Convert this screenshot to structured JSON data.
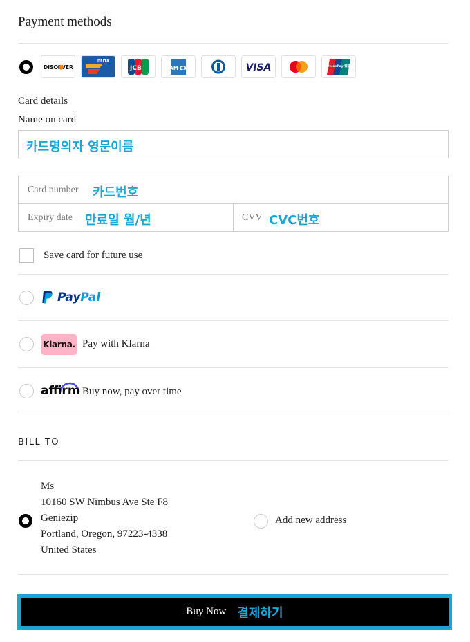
{
  "payment": {
    "title": "Payment methods",
    "card_logos": [
      "DISCOVER",
      "DELTA",
      "JCB",
      "AMEX",
      "Diners Club",
      "VISA",
      "Mastercard",
      "UnionPay"
    ],
    "card_logo_text": {
      "discover": "DISCOVER",
      "delta": "DELTA",
      "jcb": "JCB",
      "amex": "AM EX",
      "visa": "VISA",
      "unionpay": "UnionPay 银联"
    },
    "card_details_label": "Card details",
    "name_on_card_label": "Name on card",
    "name_on_card_value": "카드명의자 영문이름",
    "card_number_placeholder": "Card number",
    "card_number_value": "카드번호",
    "expiry_placeholder": "Expiry date",
    "expiry_value": "만료일 월/년",
    "cvv_placeholder": "CVV",
    "cvv_value": "CVC번호",
    "save_card_label": "Save card for future use",
    "paypal_p1": "Pay",
    "paypal_p2": "Pal",
    "klarna_badge": "Klarna.",
    "klarna_label": "Pay with Klarna",
    "affirm_logo": "affirm",
    "affirm_label": "Buy now, pay over time"
  },
  "bill_to": {
    "heading": "BILL TO",
    "address_lines": [
      "Ms",
      "10160 SW Nimbus Ave Ste F8",
      "Geniezip",
      "Portland, Oregon, 97223-4338",
      "United States"
    ],
    "add_new_label": "Add new address"
  },
  "buy": {
    "label": "Buy Now",
    "annotation": "결제하기"
  },
  "colors": {
    "annotation": "#18a7d6",
    "button_border": "#1aa3d3",
    "button_bg": "#000000",
    "klarna_pink": "#ffb3c7",
    "paypal_dark": "#003087",
    "paypal_light": "#009cde"
  }
}
